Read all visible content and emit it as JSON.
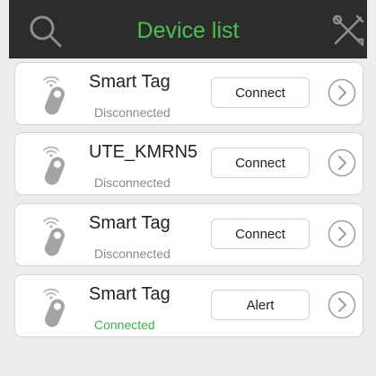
{
  "header": {
    "title": "Device list",
    "left_icon": "search-icon",
    "right_icon": "tools-icon"
  },
  "devices": [
    {
      "name": "Smart Tag",
      "status": "Disconnected",
      "action": "Connect"
    },
    {
      "name": "UTE_KMRN5",
      "status": "Disconnected",
      "action": "Connect"
    },
    {
      "name": "Smart Tag",
      "status": "Disconnected",
      "action": "Connect"
    },
    {
      "name": "Smart Tag",
      "status": "Connected",
      "action": "Alert"
    }
  ],
  "colors": {
    "header_bg": "#2c2c2c",
    "title_green": "#4fbf52",
    "connected_green": "#3aae4f",
    "disconnected_gray": "#8a8a8a"
  }
}
